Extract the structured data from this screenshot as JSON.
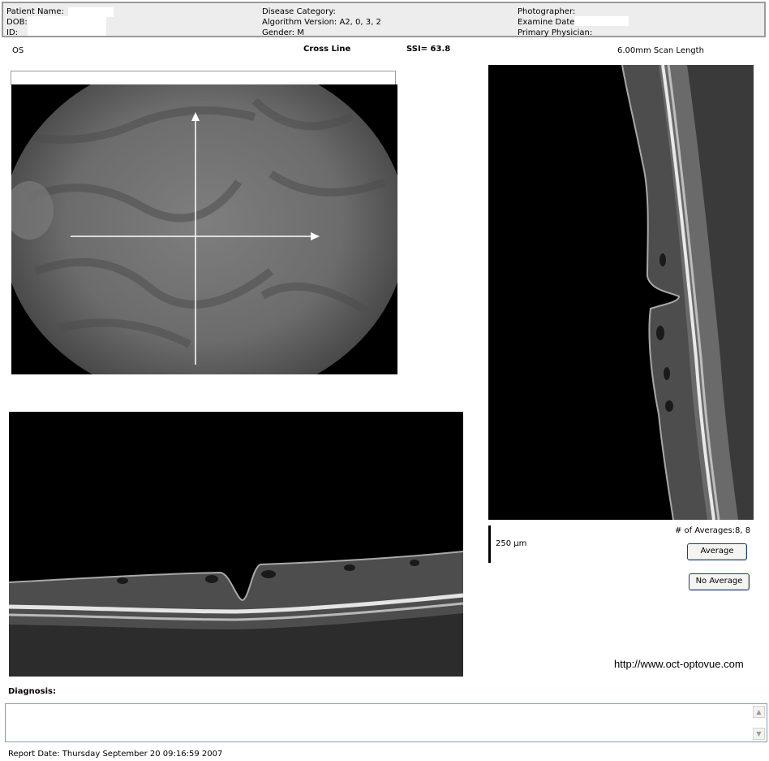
{
  "header": {
    "patient_name_label": "Patient Name:",
    "dob_label": "DOB:",
    "id_label": "ID:",
    "disease_category_label": "Disease Category:",
    "algorithm_version": "Algorithm Version: A2, 0, 3, 2",
    "gender": "Gender: M",
    "photographer_label": "Photographer:",
    "examine_date_label": "Examine Date:",
    "primary_physician_label": "Primary Physician:"
  },
  "scan": {
    "eye": "OS",
    "mode": "Cross Line",
    "ssi": "SSI= 63.8",
    "scan_length": "6.00mm Scan Length"
  },
  "oct_panel": {
    "scale_label": "250 µm",
    "averages": "# of Averages:8, 8",
    "average_button": "Average",
    "no_average_button": "No Average"
  },
  "footer": {
    "url": "http://www.oct-optovue.com",
    "diagnosis_label": "Diagnosis:",
    "diagnosis_text": "",
    "report_date": "Report Date: Thursday September 20 09:16:59 2007"
  },
  "colors": {
    "header_bg": "#ededed",
    "button_border": "#1c3f74",
    "textbox_border": "#7f9db9"
  }
}
